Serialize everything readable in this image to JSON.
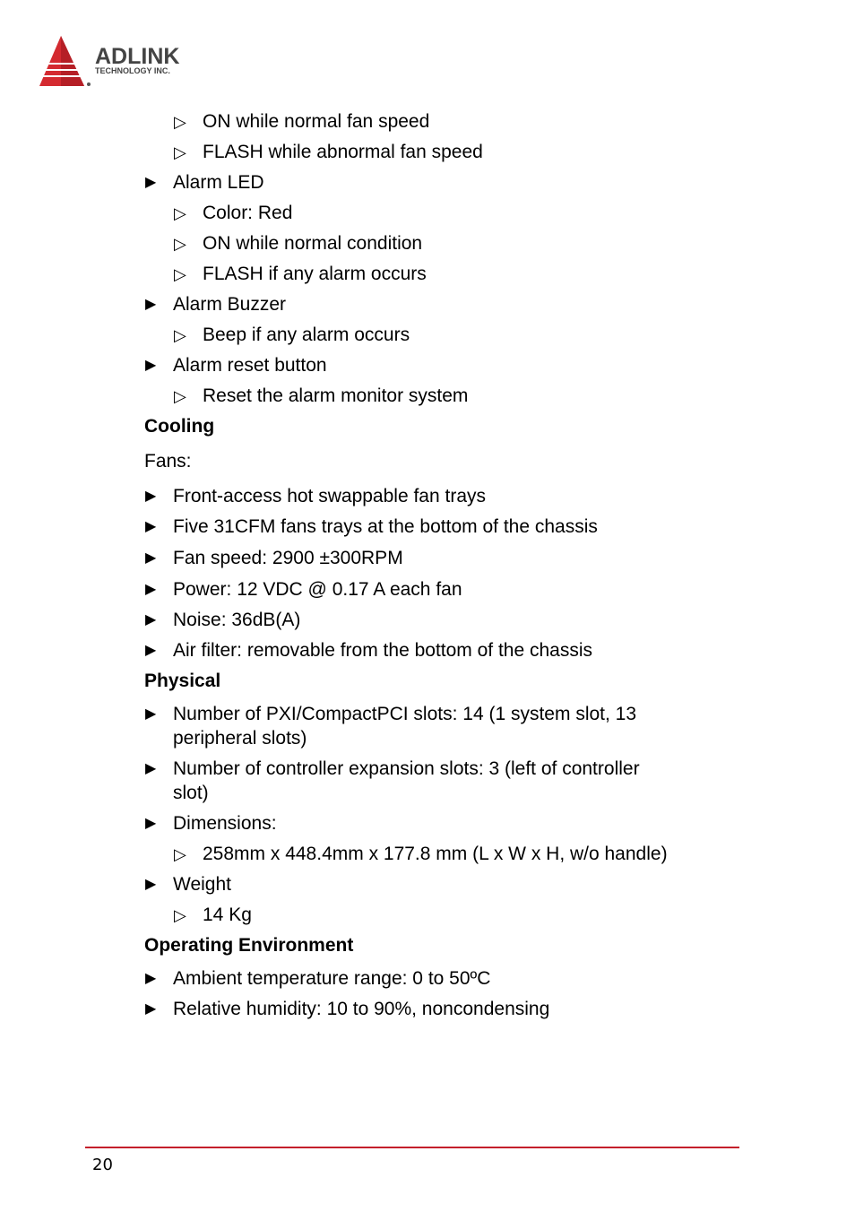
{
  "header": {
    "logo_brand": "ADLINK",
    "logo_subtitle": "TECHNOLOGY INC.",
    "brand_color": "#d42a30"
  },
  "content": {
    "fan_led_items": [
      "ON while normal fan speed",
      "FLASH while abnormal fan speed"
    ],
    "alarm_led": {
      "label": "Alarm LED",
      "items": [
        "Color: Red",
        "ON while normal condition",
        "FLASH if any alarm occurs"
      ]
    },
    "alarm_buzzer": {
      "label": "Alarm Buzzer",
      "items": [
        "Beep if any alarm occurs"
      ]
    },
    "alarm_reset": {
      "label": "Alarm reset button",
      "items": [
        "Reset the alarm monitor system"
      ]
    },
    "cooling": {
      "heading": "Cooling",
      "intro": "Fans:",
      "items": [
        "Front-access hot swappable fan trays",
        "Five 31CFM fans trays at the bottom of the chassis",
        "Fan speed: 2900 ±300RPM",
        "Power: 12 VDC @ 0.17 A each fan",
        "Noise: 36dB(A)",
        "Air filter: removable from the bottom of the chassis"
      ]
    },
    "physical": {
      "heading": "Physical",
      "slots_line1": "Number of PXI/CompactPCI slots: 14 (1 system slot, 13",
      "slots_line2": "peripheral slots)",
      "expansion_line1": "Number of controller expansion slots: 3 (left of controller",
      "expansion_line2": "slot)",
      "dimensions": {
        "label": "Dimensions:",
        "value": "258mm x 448.4mm x 177.8 mm (L x W x H, w/o handle)"
      },
      "weight": {
        "label": "Weight",
        "value": "14 Kg"
      }
    },
    "environment": {
      "heading": "Operating Environment",
      "items": [
        "Ambient temperature range: 0 to 50ºC",
        "Relative humidity: 10 to 90%, noncondensing"
      ]
    },
    "bullets": {
      "filled": "▶",
      "hollow": "▷"
    }
  },
  "footer": {
    "page_number": "20",
    "rule_color": "#c4202b"
  }
}
